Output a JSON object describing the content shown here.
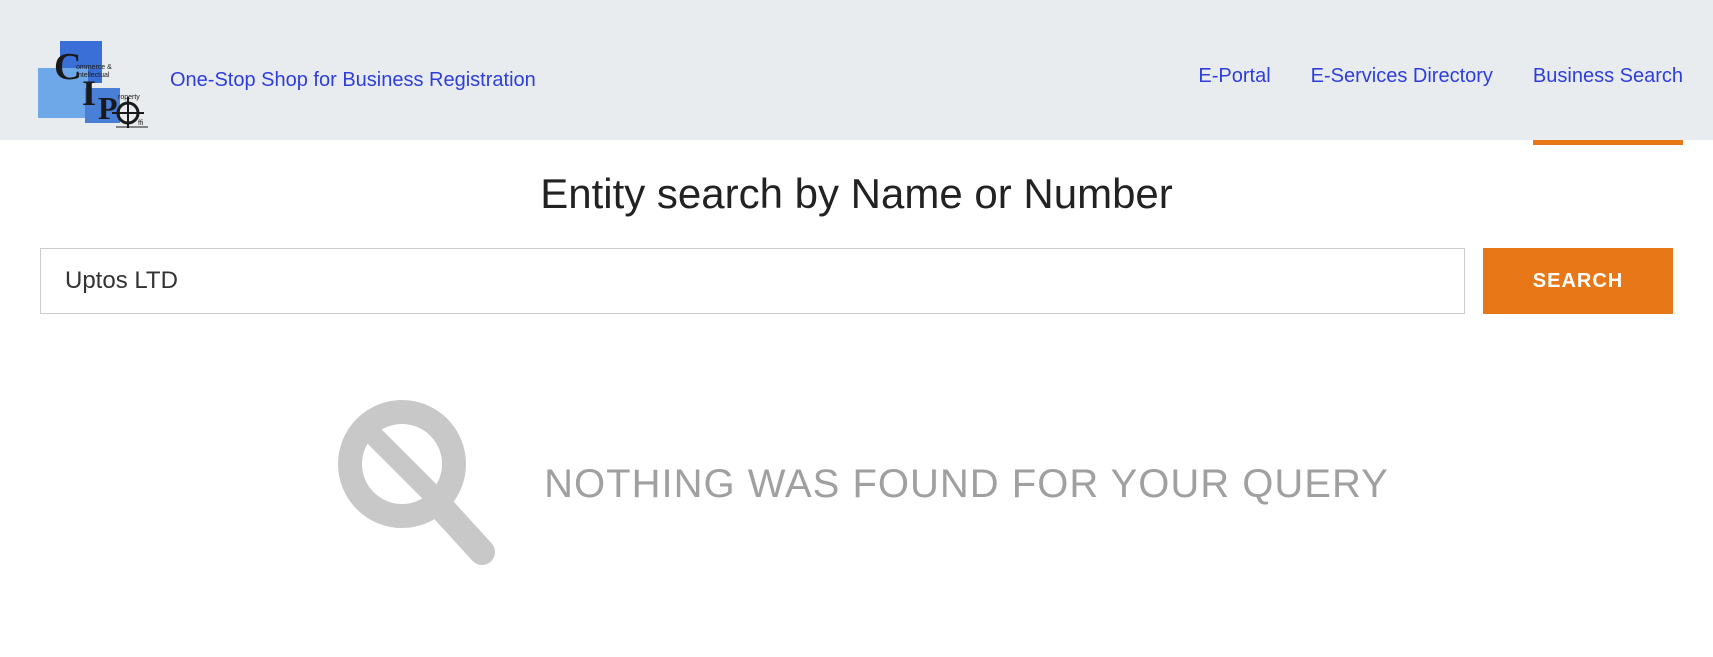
{
  "header": {
    "tagline": "One-Stop Shop for Business Registration",
    "nav": {
      "eportal": "E-Portal",
      "eservices": "E-Services Directory",
      "business_search": "Business Search"
    }
  },
  "main": {
    "title": "Entity search by Name or Number",
    "search_value": "Uptos LTD",
    "search_button": "SEARCH",
    "no_results_message": "NOTHING WAS FOUND FOR YOUR QUERY"
  }
}
